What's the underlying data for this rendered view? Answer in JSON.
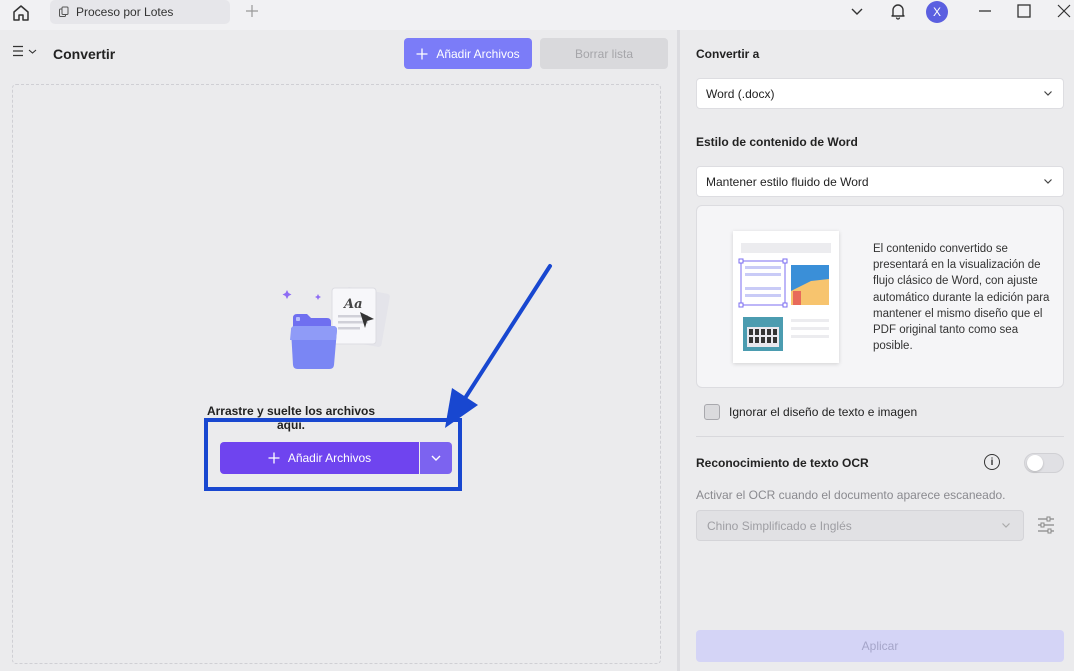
{
  "tab": {
    "title": "Proceso por Lotes"
  },
  "user": {
    "initial": "X"
  },
  "left": {
    "title": "Convertir",
    "add_files_label": "Añadir Archivos",
    "clear_list_label": "Borrar lista",
    "drop_text": "Arrastre y suelte los archivos aquí.",
    "add_files_main_label": "Añadir Archivos"
  },
  "right": {
    "convert_to_label": "Convertir a",
    "convert_to_value": "Word (.docx)",
    "style_label": "Estilo de contenido de Word",
    "style_value": "Mantener estilo fluido de Word",
    "style_description": "El contenido convertido se presentará en la visualización de flujo clásico de Word, con ajuste automático durante la edición para mantener el mismo diseño que el PDF original tanto como sea posible.",
    "ignore_layout_label": "Ignorar el diseño de texto e imagen",
    "ignore_layout_checked": false,
    "ocr_label": "Reconocimiento de texto OCR",
    "ocr_enabled": false,
    "ocr_sub": "Activar el OCR cuando el documento aparece escaneado.",
    "ocr_language": "Chino Simplificado e Inglés",
    "apply_label": "Aplicar"
  },
  "colors": {
    "accent": "#6f44ef",
    "accent_light": "#7b7cf8",
    "annotation": "#1847d0"
  },
  "icons": [
    "home-icon",
    "tab-icon",
    "plus-icon",
    "chevron-down-icon",
    "bell-icon",
    "minimize-icon",
    "maximize-icon",
    "close-icon",
    "menu-icon",
    "info-icon",
    "settings-sliders-icon"
  ]
}
